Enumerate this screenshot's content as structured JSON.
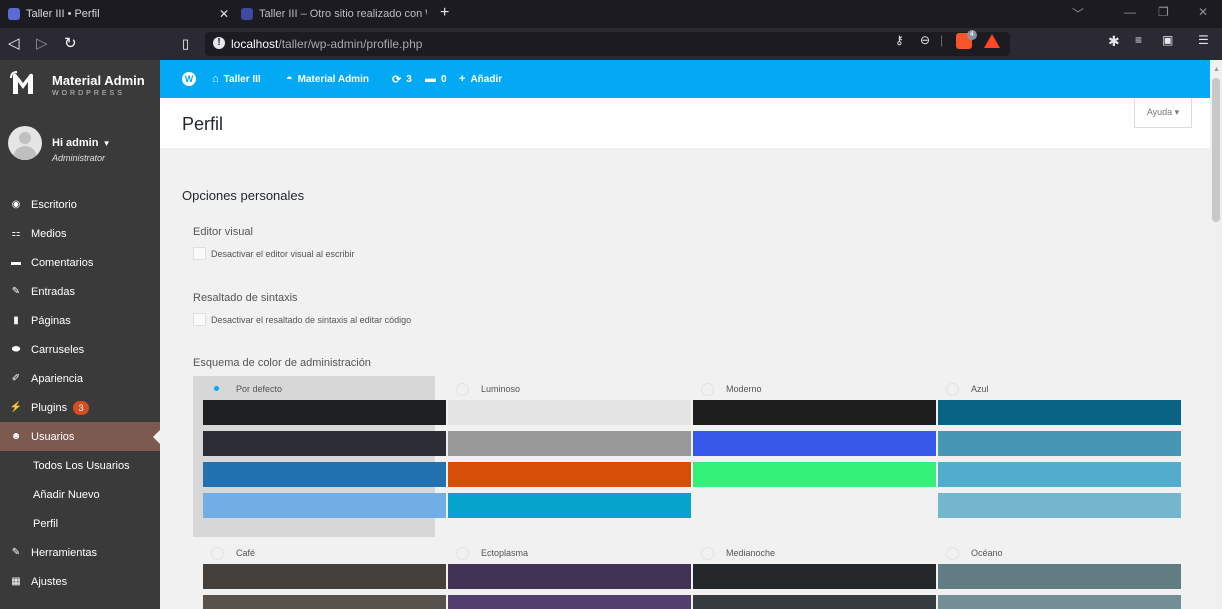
{
  "browser": {
    "tabs": [
      {
        "title": "Taller III • Perfil",
        "active": true,
        "close": "✕"
      },
      {
        "title": "Taller III – Otro sitio realizado con Wor",
        "active": false
      }
    ],
    "new_tab": "+",
    "url_host": "localhost",
    "url_path": "/taller/wp-admin/profile.php",
    "shield_count": "4"
  },
  "sidebar": {
    "brand_name": "Material Admin",
    "brand_sub": "WORDPRESS",
    "greeting": "Hi admin",
    "role": "Administrator",
    "items": [
      {
        "label": "Escritorio",
        "icon": "dashboard-icon",
        "glyph": "◉"
      },
      {
        "label": "Medios",
        "icon": "media-icon",
        "glyph": "⚏"
      },
      {
        "label": "Comentarios",
        "icon": "comment-icon",
        "glyph": "▬"
      },
      {
        "label": "Entradas",
        "icon": "pin-icon",
        "glyph": "✎"
      },
      {
        "label": "Páginas",
        "icon": "page-icon",
        "glyph": "▮"
      },
      {
        "label": "Carruseles",
        "icon": "carousel-icon",
        "glyph": "⬬"
      },
      {
        "label": "Apariencia",
        "icon": "brush-icon",
        "glyph": "✐"
      },
      {
        "label": "Plugins",
        "icon": "plugin-icon",
        "glyph": "⚡",
        "badge": "3"
      },
      {
        "label": "Usuarios",
        "icon": "users-icon",
        "glyph": "☻",
        "active": true
      }
    ],
    "submenu": [
      "Todos Los Usuarios",
      "Añadir Nuevo",
      "Perfil"
    ],
    "items_after": [
      {
        "label": "Herramientas",
        "icon": "wrench-icon",
        "glyph": "✎"
      },
      {
        "label": "Ajustes",
        "icon": "settings-icon",
        "glyph": "▦"
      }
    ]
  },
  "adminbar": {
    "site": "Taller III",
    "theme": "Material Admin",
    "updates": "3",
    "comments": "0",
    "add": "Añadir"
  },
  "page": {
    "title": "Perfil",
    "help": "Ayuda ▾"
  },
  "options": {
    "section_title": "Opciones personales",
    "visual_editor_label": "Editor visual",
    "visual_editor_checkbox": "Desactivar el editor visual al escribir",
    "syntax_label": "Resaltado de sintaxis",
    "syntax_checkbox": "Desactivar el resaltado de sintaxis al editar código",
    "color_scheme_label": "Esquema de color de administración"
  },
  "color_schemes": [
    {
      "name": "Por defecto",
      "selected": true,
      "colors": [
        "#1e1f21",
        "#2b2e34",
        "#2271b1",
        "#72aee6"
      ]
    },
    {
      "name": "Luminoso",
      "selected": false,
      "colors": [
        "#e5e5e5",
        "#999999",
        "#d64e07",
        "#04a4cc"
      ]
    },
    {
      "name": "Moderno",
      "selected": false,
      "colors": [
        "#1e1e1e",
        "#3858e9",
        "#33f078",
        ""
      ]
    },
    {
      "name": "Azul",
      "selected": false,
      "colors": [
        "#096484",
        "#4796b3",
        "#52accc",
        "#74b6ce"
      ]
    },
    {
      "name": "Café",
      "selected": false,
      "colors": [
        "#46403c",
        "#59524c"
      ]
    },
    {
      "name": "Ectoplasma",
      "selected": false,
      "colors": [
        "#413256",
        "#523f6d"
      ]
    },
    {
      "name": "Medianoche",
      "selected": false,
      "colors": [
        "#25282b",
        "#363b3f"
      ]
    },
    {
      "name": "Océano",
      "selected": false,
      "colors": [
        "#627c83",
        "#738e96"
      ]
    }
  ]
}
